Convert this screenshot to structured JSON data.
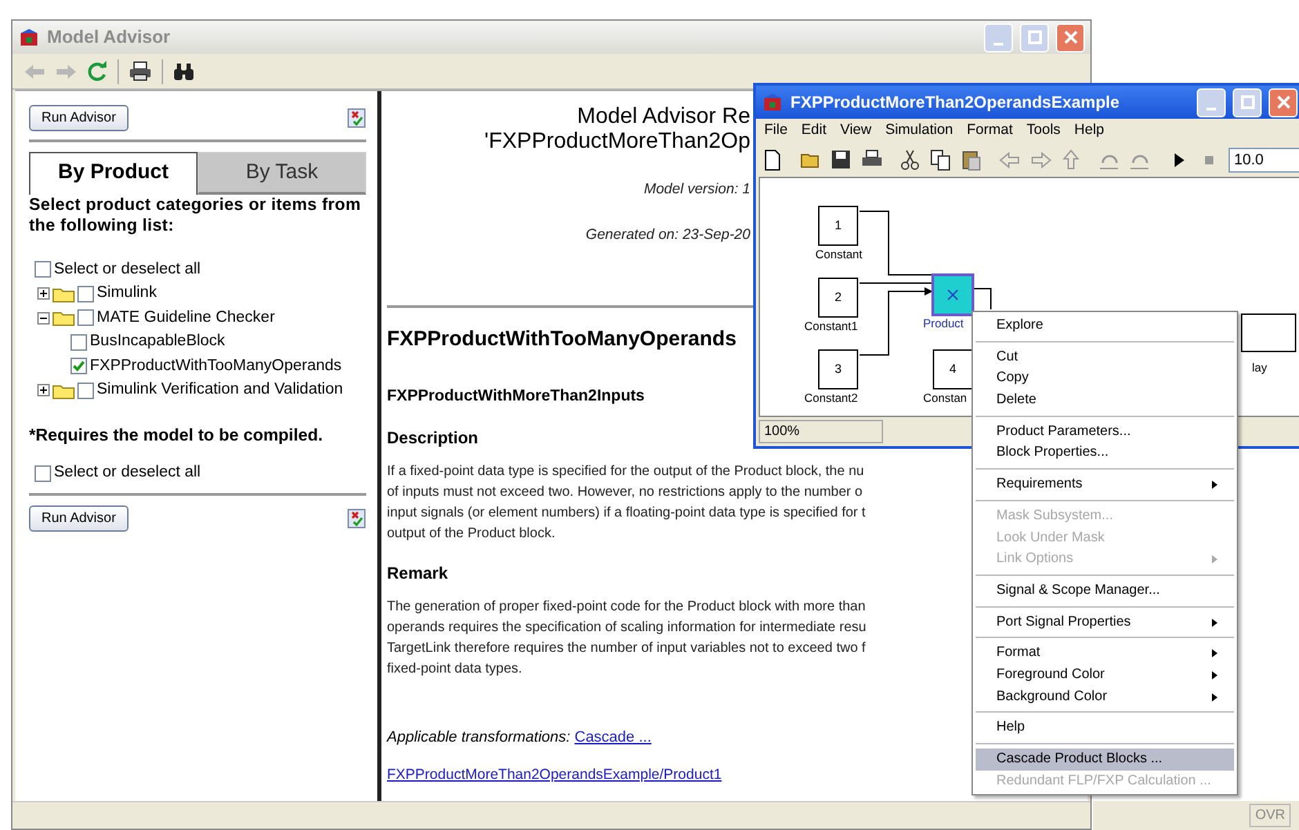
{
  "advisor_window": {
    "title": "Model Advisor",
    "run_button": "Run Advisor",
    "tabs": [
      {
        "label": "By Product",
        "selected": true
      },
      {
        "label": "By Task",
        "selected": false
      }
    ],
    "instructions": "Select product categories or items from the following list:",
    "select_all": {
      "label": "Select or deselect all",
      "checked": false
    },
    "tree": [
      {
        "kind": "folder",
        "label": "Simulink",
        "checked": false,
        "expanded": false
      },
      {
        "kind": "folder",
        "label": "MATE Guideline Checker",
        "checked": false,
        "expanded": true,
        "children": [
          {
            "kind": "item",
            "label": "BusIncapableBlock",
            "checked": false
          },
          {
            "kind": "item",
            "label": "FXPProductWithTooManyOperands",
            "checked": true
          }
        ]
      },
      {
        "kind": "folder",
        "label": "Simulink Verification and Validation",
        "checked": false,
        "expanded": false
      }
    ],
    "note": "*Requires the model to be compiled.",
    "select_all_2": {
      "label": "Select or deselect all",
      "checked": false
    },
    "run_button_2": "Run Advisor",
    "report": {
      "title_lines": [
        "Model Advisor Re",
        "'FXPProductMoreThan2Op"
      ],
      "model_version": "Model version: 1",
      "generated_on": "Generated on: 23-Sep-20",
      "check_title": "FXPProductWithTooManyOperands",
      "check_id": "FXPProductWithMoreThan2Inputs",
      "sections": [
        {
          "heading": "Description",
          "lines": [
            "If a fixed-point data type is specified for the output of the Product block, the nu",
            "of inputs must not exceed two. However, no restrictions apply to the number o",
            "input signals (or element numbers) if a floating-point data type is specified for t",
            "output of the Product block."
          ]
        },
        {
          "heading": "Remark",
          "lines": [
            "The generation of proper fixed-point code for the Product block with more than",
            "operands requires the specification of scaling information for intermediate resu",
            "TargetLink therefore requires the number of input variables not to exceed two f",
            "fixed-point data types."
          ]
        }
      ],
      "transformations_label": "Applicable transformations:",
      "transformations_link": "Cascade ...",
      "block_link": "FXPProductMoreThan2OperandsExample/Product1"
    }
  },
  "model_window": {
    "title": "FXPProductMoreThan2OperandsExample",
    "menus": [
      "File",
      "Edit",
      "View",
      "Simulation",
      "Format",
      "Tools",
      "Help"
    ],
    "stop_time": "10.0",
    "blocks": [
      {
        "kind": "constant",
        "value": "1",
        "label": "Constant",
        "selected": false
      },
      {
        "kind": "constant",
        "value": "2",
        "label": "Constant1",
        "selected": false
      },
      {
        "kind": "constant",
        "value": "3",
        "label": "Constant2",
        "selected": false
      },
      {
        "kind": "product",
        "label": "Product",
        "selected": true
      },
      {
        "kind": "constant",
        "value": "4",
        "label": "Constan",
        "selected": false
      },
      {
        "kind": "display",
        "label": "lay",
        "selected": false
      }
    ],
    "zoom": "100%"
  },
  "context_menu": {
    "groups": [
      [
        {
          "label": "Explore",
          "disabled": false,
          "submenu": false,
          "selected": false
        }
      ],
      [
        {
          "label": "Cut",
          "disabled": false,
          "submenu": false,
          "selected": false
        },
        {
          "label": "Copy",
          "disabled": false,
          "submenu": false,
          "selected": false
        },
        {
          "label": "Delete",
          "disabled": false,
          "submenu": false,
          "selected": false
        }
      ],
      [
        {
          "label": "Product Parameters...",
          "disabled": false,
          "submenu": false,
          "selected": false
        },
        {
          "label": "Block Properties...",
          "disabled": false,
          "submenu": false,
          "selected": false
        }
      ],
      [
        {
          "label": "Requirements",
          "disabled": false,
          "submenu": true,
          "selected": false
        }
      ],
      [
        {
          "label": "Mask Subsystem...",
          "disabled": true,
          "submenu": false,
          "selected": false
        },
        {
          "label": "Look Under Mask",
          "disabled": true,
          "submenu": false,
          "selected": false
        },
        {
          "label": "Link Options",
          "disabled": true,
          "submenu": true,
          "selected": false
        }
      ],
      [
        {
          "label": "Signal & Scope Manager...",
          "disabled": false,
          "submenu": false,
          "selected": false
        }
      ],
      [
        {
          "label": "Port Signal Properties",
          "disabled": false,
          "submenu": true,
          "selected": false
        }
      ],
      [
        {
          "label": "Format",
          "disabled": false,
          "submenu": true,
          "selected": false
        },
        {
          "label": "Foreground Color",
          "disabled": false,
          "submenu": true,
          "selected": false
        },
        {
          "label": "Background Color",
          "disabled": false,
          "submenu": true,
          "selected": false
        }
      ],
      [
        {
          "label": "Help",
          "disabled": false,
          "submenu": false,
          "selected": false
        }
      ],
      [
        {
          "label": "Cascade Product Blocks ...",
          "disabled": false,
          "submenu": false,
          "selected": true
        },
        {
          "label": "Redundant FLP/FXP Calculation ...",
          "disabled": true,
          "submenu": false,
          "selected": false
        }
      ]
    ]
  },
  "status_bar": {
    "mode": "OVR"
  }
}
